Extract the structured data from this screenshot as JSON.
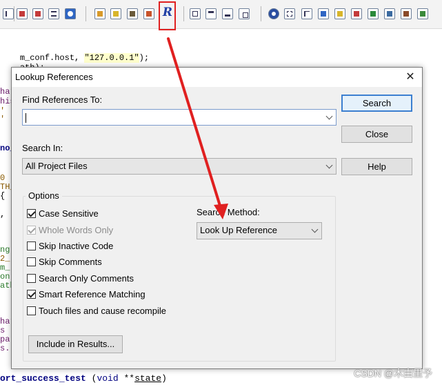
{
  "code": {
    "line1_prefix": "m_conf.host, ",
    "line1_string": "\"127.0.0.1\"",
    "line1_suffix": ");",
    "line2": "ath);",
    "fragments": [
      "har",
      "his",
      "'",
      "'",
      "no_",
      "0",
      "TH_",
      "{",
      ",",
      "ng",
      "2_",
      "m_",
      "on",
      "ath",
      "har",
      "s",
      "pa",
      "s."
    ],
    "bottom_fn": "ort_success_test",
    "bottom_open": " (",
    "bottom_kw": "void",
    "bottom_mid": " **",
    "bottom_param": "state",
    "bottom_close": ")"
  },
  "dialog": {
    "title": "Lookup References",
    "find_label": "Find References To:",
    "find_value": "",
    "search_in_label": "Search In:",
    "search_in_value": "All Project Files",
    "buttons": {
      "search": "Search",
      "close": "Close",
      "help": "Help"
    },
    "options": {
      "legend": "Options",
      "items": [
        {
          "label": "Case Sensitive",
          "checked": true,
          "disabled": false
        },
        {
          "label": "Whole Words Only",
          "checked": true,
          "disabled": true
        },
        {
          "label": "Skip Inactive Code",
          "checked": false,
          "disabled": false
        },
        {
          "label": "Skip Comments",
          "checked": false,
          "disabled": false
        },
        {
          "label": "Search Only Comments",
          "checked": false,
          "disabled": false
        },
        {
          "label": "Smart Reference Matching",
          "checked": true,
          "disabled": false
        },
        {
          "label": "Touch files and cause recompile",
          "checked": false,
          "disabled": false
        }
      ],
      "include_button": "Include in Results...",
      "method_label": "Search Method:",
      "method_value": "Look Up Reference"
    }
  },
  "toolbar": {
    "highlighted_glyph": "R",
    "highlight_color": "#e02020"
  },
  "colors": {
    "arrow": "#e02020",
    "dialog_bg": "#f0f0f0",
    "default_button_border": "#3c7fd0"
  },
  "watermark": "CSDN @木由里予"
}
